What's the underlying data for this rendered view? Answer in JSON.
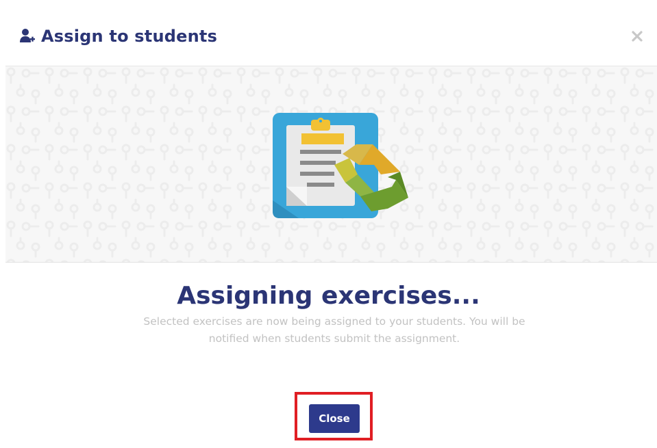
{
  "dialog": {
    "title": "Assign to students",
    "icon": "add-user-icon",
    "close_icon": "close-icon"
  },
  "banner": {
    "illustration": "clipboard-sync-icon"
  },
  "message": {
    "heading": "Assigning exercises...",
    "body": "Selected exercises are now being assigned to your students. You will be notified when students submit the assignment."
  },
  "actions": {
    "close_label": "Close"
  },
  "colors": {
    "brand": "#2b3575",
    "button": "#2d3a8c",
    "highlight": "#e01e24",
    "muted_text": "#c2c2c2"
  }
}
